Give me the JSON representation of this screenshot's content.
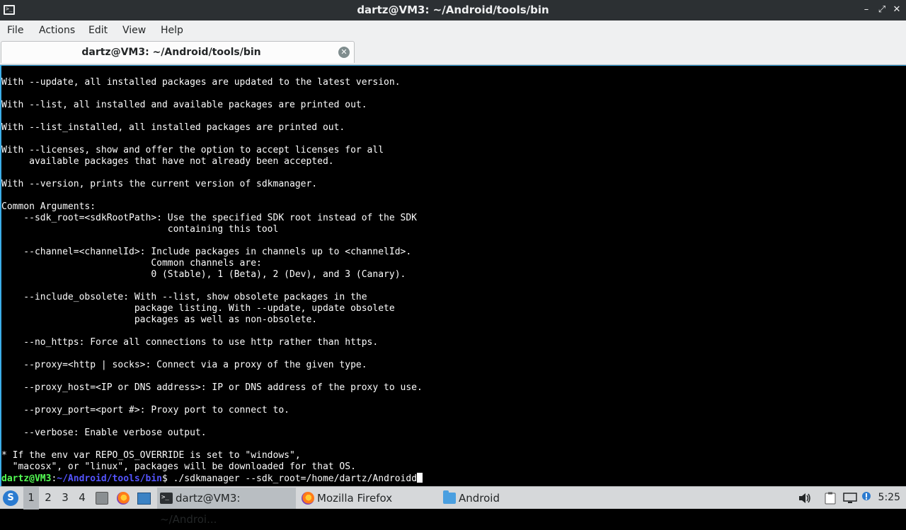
{
  "window": {
    "title": "dartz@VM3: ~/Android/tools/bin",
    "app_icon_glyph": ">_",
    "controls": {
      "minimize": "–",
      "maximize": "⤢",
      "close": "✕"
    }
  },
  "menubar": {
    "items": [
      {
        "label": "File"
      },
      {
        "label": "Actions"
      },
      {
        "label": "Edit"
      },
      {
        "label": "View"
      },
      {
        "label": "Help"
      }
    ]
  },
  "tabs": [
    {
      "label": "dartz@VM3: ~/Android/tools/bin",
      "active": true
    }
  ],
  "terminal": {
    "lines": [
      "With --update, all installed packages are updated to the latest version.",
      "",
      "With --list, all installed and available packages are printed out.",
      "",
      "With --list_installed, all installed packages are printed out.",
      "",
      "With --licenses, show and offer the option to accept licenses for all",
      "     available packages that have not already been accepted.",
      "",
      "With --version, prints the current version of sdkmanager.",
      "",
      "Common Arguments:",
      "    --sdk_root=<sdkRootPath>: Use the specified SDK root instead of the SDK",
      "                              containing this tool",
      "",
      "    --channel=<channelId>: Include packages in channels up to <channelId>.",
      "                           Common channels are:",
      "                           0 (Stable), 1 (Beta), 2 (Dev), and 3 (Canary).",
      "",
      "    --include_obsolete: With --list, show obsolete packages in the",
      "                        package listing. With --update, update obsolete",
      "                        packages as well as non-obsolete.",
      "",
      "    --no_https: Force all connections to use http rather than https.",
      "",
      "    --proxy=<http | socks>: Connect via a proxy of the given type.",
      "",
      "    --proxy_host=<IP or DNS address>: IP or DNS address of the proxy to use.",
      "",
      "    --proxy_port=<port #>: Proxy port to connect to.",
      "",
      "    --verbose: Enable verbose output.",
      "",
      "* If the env var REPO_OS_OVERRIDE is set to \"windows\",",
      "  \"macosx\", or \"linux\", packages will be downloaded for that OS."
    ],
    "prompt": {
      "user_host": "dartz@VM3",
      "separator": ":",
      "path": "~/Android/tools/bin",
      "symbol": "$",
      "command": " ./sdkmanager --sdk_root=/home/dartz/Androidd"
    },
    "colors": {
      "background": "#000000",
      "text": "#fcfcfc",
      "user": "#54ff54",
      "path": "#5454ff"
    }
  },
  "taskbar": {
    "start_icon": "start-menu-icon",
    "desktops": [
      "1",
      "2",
      "3",
      "4"
    ],
    "active_desktop": "1",
    "quick_launch": [
      "show-desktop-icon",
      "firefox-icon",
      "desktop-icon"
    ],
    "tasks": [
      {
        "label": "dartz@VM3: ~/Androi...",
        "icon": "terminal-icon",
        "active": true
      },
      {
        "label": "Mozilla Firefox",
        "icon": "firefox-icon",
        "active": false
      },
      {
        "label": "Android",
        "icon": "folder-icon",
        "active": false
      }
    ],
    "tray": [
      "volume-icon",
      "clipboard-icon",
      "display-icon",
      "update-icon"
    ],
    "clock": "5:25"
  }
}
